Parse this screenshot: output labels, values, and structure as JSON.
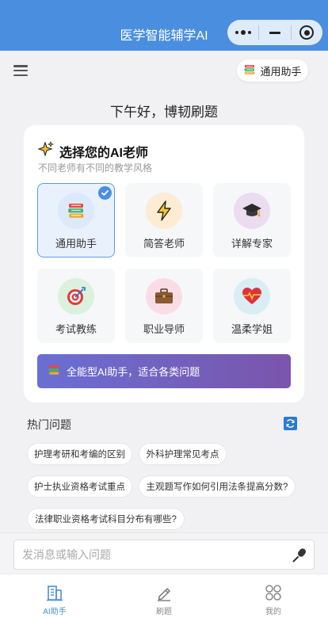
{
  "header": {
    "title": "医学智能辅学AI"
  },
  "toolbar": {
    "assistant_label": "通用助手"
  },
  "greeting": "下午好，博韧刷题",
  "teacher_card": {
    "title": "选择您的AI老师",
    "subtitle": "不同老师有不同的教学风格",
    "teachers": [
      {
        "label": "通用助手",
        "icon": "books-icon",
        "selected": true
      },
      {
        "label": "简答老师",
        "icon": "lightning-icon",
        "selected": false
      },
      {
        "label": "详解专家",
        "icon": "graduation-cap-icon",
        "selected": false
      },
      {
        "label": "考试教练",
        "icon": "target-icon",
        "selected": false
      },
      {
        "label": "职业导师",
        "icon": "briefcase-icon",
        "selected": false
      },
      {
        "label": "温柔学姐",
        "icon": "heart-icon",
        "selected": false
      }
    ],
    "banner_text": "全能型AI助手，适合各类问题"
  },
  "hot": {
    "title": "热门问题",
    "questions": [
      "护理考研和考编的区别",
      "外科护理常见考点",
      "护士执业资格考试重点",
      "主观题写作如何引用法条提高分数?",
      "法律职业资格考试科目分布有哪些?"
    ]
  },
  "input": {
    "placeholder": "发消息或输入问题"
  },
  "tabs": [
    {
      "label": "AI助手",
      "icon": "building-icon",
      "active": true
    },
    {
      "label": "刷题",
      "icon": "pencil-icon",
      "active": false
    },
    {
      "label": "我的",
      "icon": "grid-icon",
      "active": false
    }
  ],
  "colors": {
    "primary": "#4a8ee0",
    "banner_start": "#6a6fd3",
    "banner_end": "#7a55ab"
  }
}
